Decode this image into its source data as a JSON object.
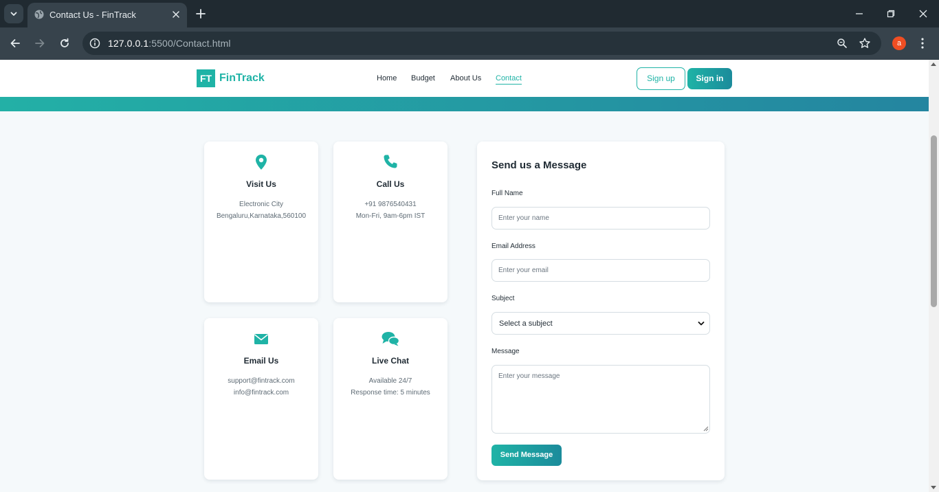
{
  "browser": {
    "tab_title": "Contact Us - FinTrack",
    "url_host": "127.0.0.1",
    "url_path": ":5500/Contact.html",
    "profile_initial": "a"
  },
  "site": {
    "logo_mark": "FT",
    "logo_text": "FinTrack",
    "nav": [
      {
        "label": "Home",
        "active": false
      },
      {
        "label": "Budget",
        "active": false
      },
      {
        "label": "About Us",
        "active": false
      },
      {
        "label": "Contact",
        "active": true
      }
    ],
    "signup_label": "Sign up",
    "signin_label": "Sign in",
    "accent_color": "#1fb3a6",
    "band_gradient": [
      "#23b0a6",
      "#2485a0"
    ]
  },
  "cards": [
    {
      "icon": "location-pin-icon",
      "title": "Visit Us",
      "lines": [
        "Electronic City",
        "Bengaluru,Karnataka,560100"
      ]
    },
    {
      "icon": "phone-icon",
      "title": "Call Us",
      "lines": [
        "+91 9876540431",
        "Mon-Fri, 9am-6pm IST"
      ]
    },
    {
      "icon": "envelope-icon",
      "title": "Email Us",
      "lines": [
        "support@fintrack.com",
        "info@fintrack.com"
      ]
    },
    {
      "icon": "chat-bubbles-icon",
      "title": "Live Chat",
      "lines": [
        "Available 24/7",
        "Response time: 5 minutes"
      ]
    }
  ],
  "form": {
    "title": "Send us a Message",
    "name_label": "Full Name",
    "name_placeholder": "Enter your name",
    "name_value": "",
    "email_label": "Email Address",
    "email_placeholder": "Enter your email",
    "email_value": "",
    "subject_label": "Subject",
    "subject_selected": "Select a subject",
    "message_label": "Message",
    "message_placeholder": "Enter your message",
    "message_value": "",
    "submit_label": "Send Message"
  }
}
